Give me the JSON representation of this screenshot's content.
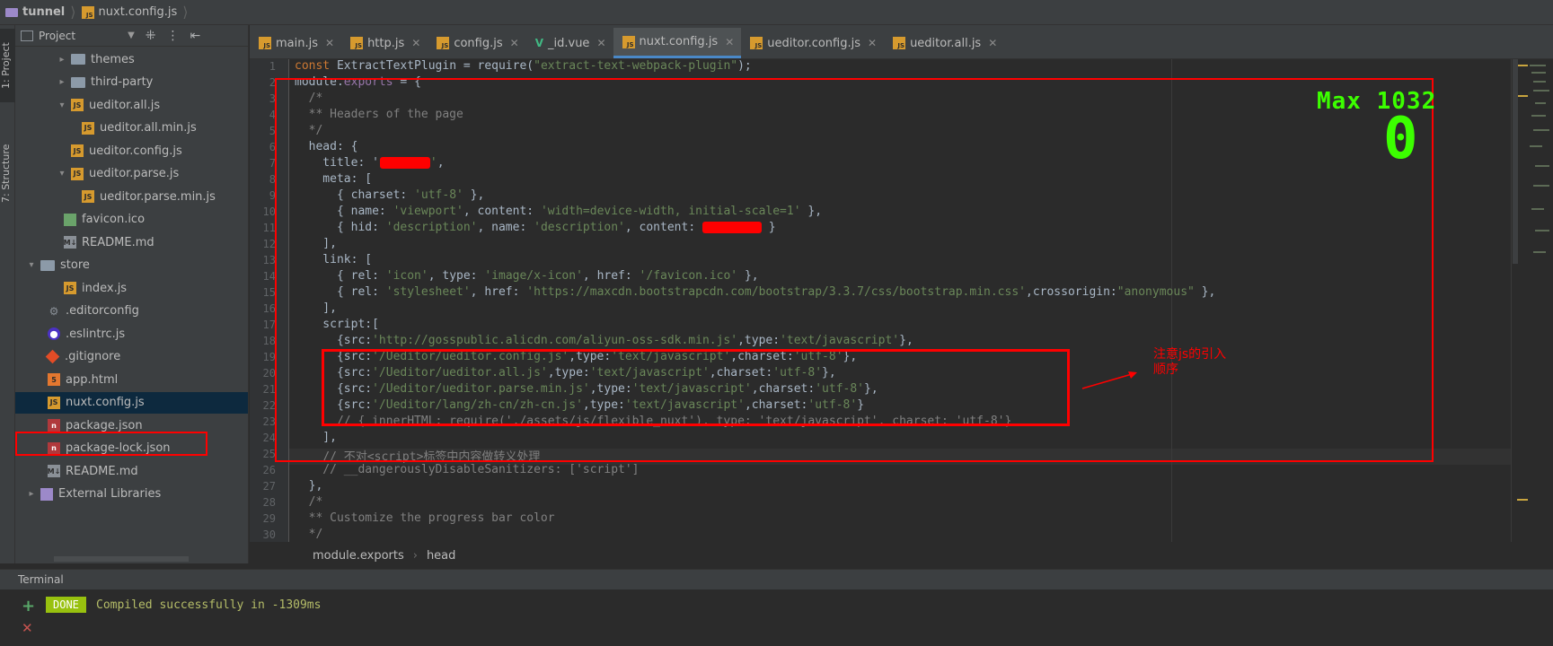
{
  "titlebar": {
    "project": "tunnel",
    "file": "nuxt.config.js"
  },
  "left_stripe": {
    "project_tab": "1: Project",
    "structure_tab": "7: Structure"
  },
  "project_panel": {
    "title": "Project",
    "tree": [
      {
        "label": "themes",
        "type": "folder",
        "arrow": "▸"
      },
      {
        "label": "third-party",
        "type": "folder",
        "arrow": "▸"
      },
      {
        "label": "ueditor.all.js",
        "type": "js",
        "arrow": "▾"
      },
      {
        "label": "ueditor.all.min.js",
        "type": "js",
        "arrow": ""
      },
      {
        "label": "ueditor.config.js",
        "type": "js",
        "arrow": ""
      },
      {
        "label": "ueditor.parse.js",
        "type": "js",
        "arrow": "▾"
      },
      {
        "label": "ueditor.parse.min.js",
        "type": "js",
        "arrow": ""
      },
      {
        "label": "favicon.ico",
        "type": "img",
        "arrow": ""
      },
      {
        "label": "README.md",
        "type": "md",
        "arrow": ""
      },
      {
        "label": "store",
        "type": "folder",
        "arrow": "▾"
      },
      {
        "label": "index.js",
        "type": "js",
        "arrow": ""
      },
      {
        "label": ".editorconfig",
        "type": "cfg",
        "arrow": ""
      },
      {
        "label": ".eslintrc.js",
        "type": "eslint",
        "arrow": ""
      },
      {
        "label": ".gitignore",
        "type": "git",
        "arrow": ""
      },
      {
        "label": "app.html",
        "type": "html",
        "arrow": ""
      },
      {
        "label": "nuxt.config.js",
        "type": "js",
        "arrow": ""
      },
      {
        "label": "package.json",
        "type": "npm",
        "arrow": ""
      },
      {
        "label": "package-lock.json",
        "type": "npm",
        "arrow": ""
      },
      {
        "label": "README.md",
        "type": "md",
        "arrow": ""
      },
      {
        "label": "External Libraries",
        "type": "lib",
        "arrow": "▸"
      }
    ]
  },
  "tabs": [
    {
      "label": "main.js",
      "icon": "js"
    },
    {
      "label": "http.js",
      "icon": "js"
    },
    {
      "label": "config.js",
      "icon": "js"
    },
    {
      "label": "_id.vue",
      "icon": "vue"
    },
    {
      "label": "nuxt.config.js",
      "icon": "js",
      "active": true
    },
    {
      "label": "ueditor.config.js",
      "icon": "js"
    },
    {
      "label": "ueditor.all.js",
      "icon": "js"
    }
  ],
  "code": {
    "line_numbers": [
      "1",
      "2",
      "3",
      "4",
      "5",
      "6",
      "7",
      "8",
      "9",
      "10",
      "11",
      "12",
      "13",
      "14",
      "15",
      "16",
      "17",
      "18",
      "19",
      "20",
      "21",
      "22",
      "23",
      "24",
      "25",
      "26",
      "27",
      "28",
      "29",
      "30"
    ],
    "lines": [
      "const ExtractTextPlugin = require(\"extract-text-webpack-plugin\");",
      "module.exports = {",
      "  /*",
      "  ** Headers of the page",
      "  */",
      "  head: {",
      "    title: '",
      "    meta: [",
      "      { charset: 'utf-8' },",
      "      { name: 'viewport', content: 'width=device-width, initial-scale=1' },",
      "      { hid: 'description', name: 'description', content: ",
      "    ],",
      "    link: [",
      "      { rel: 'icon', type: 'image/x-icon', href: '/favicon.ico' },",
      "      { rel: 'stylesheet', href: 'https://maxcdn.bootstrapcdn.com/bootstrap/3.3.7/css/bootstrap.min.css',crossorigin:\"anonymous\" },",
      "    ],",
      "    script:[",
      "      {src:'http://gosspublic.alicdn.com/aliyun-oss-sdk.min.js',type:'text/javascript'},",
      "      {src:'/Ueditor/ueditor.config.js',type:'text/javascript',charset:'utf-8'},",
      "      {src:'/Ueditor/ueditor.all.js',type:'text/javascript',charset:'utf-8'},",
      "      {src:'/Ueditor/ueditor.parse.min.js',type:'text/javascript',charset:'utf-8'},",
      "      {src:'/Ueditor/lang/zh-cn/zh-cn.js',type:'text/javascript',charset:'utf-8'}",
      "      // { innerHTML: require('./assets/js/flexible_nuxt'), type: 'text/javascript', charset: 'utf-8'}",
      "    ],",
      "    // 不对<script>标签中内容做转义处理",
      "    // __dangerouslyDisableSanitizers: ['script']",
      "  },",
      "  /*",
      "  ** Customize the progress bar color",
      "  */"
    ]
  },
  "annotation": {
    "text_line1": "注意js的引入",
    "text_line2": "顺序"
  },
  "overlay": {
    "max_label": "Max 1032",
    "counter": "0"
  },
  "editor_breadcrumbs": [
    "module.exports",
    "head"
  ],
  "terminal": {
    "title": "Terminal",
    "badge": "DONE",
    "message": "Compiled successfully in -1309ms"
  },
  "colors": {
    "accent": "#4a88c7",
    "annotation": "#ff0000",
    "overlay_text": "#3cff00",
    "done_badge": "#98c10f"
  }
}
